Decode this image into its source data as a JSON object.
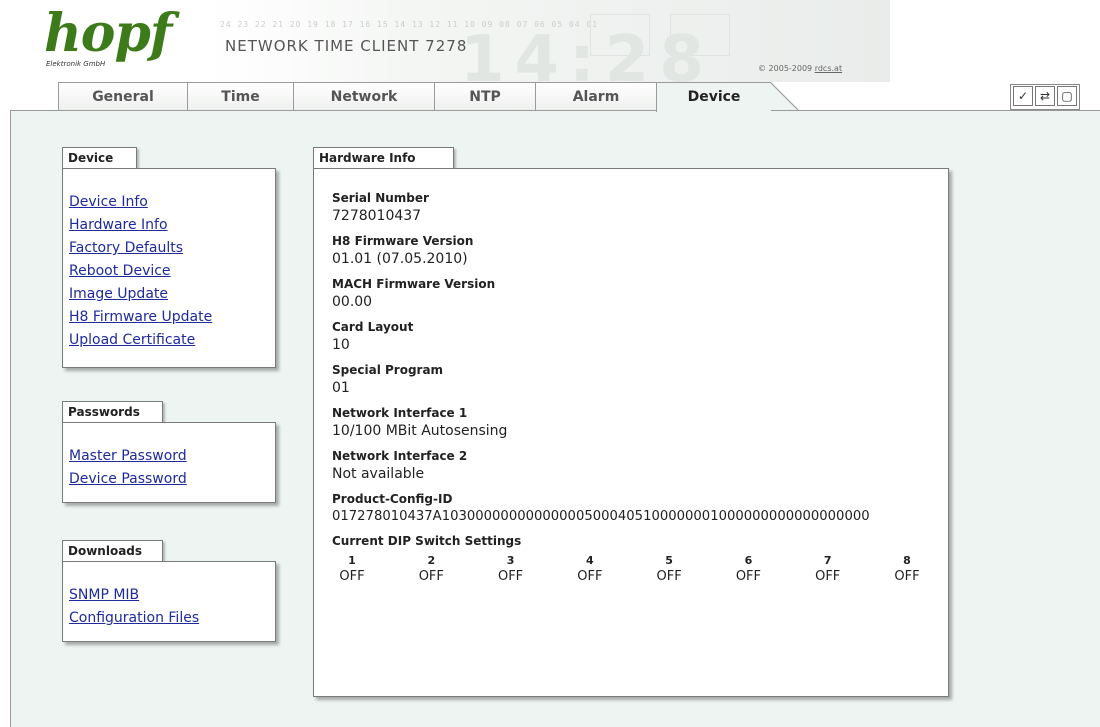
{
  "header": {
    "logo_text": "hopf",
    "logo_sub": "Elektronik GmbH",
    "title": "NETWORK TIME CLIENT 7278",
    "banner_ticks": "24 23 22 21 20 19 18 17 16 15 14 13 12 11 10 09 08 07 06 05 04 01",
    "banner_clock": "14:28",
    "copyright_text": "© 2005-2009",
    "copyright_link": "rdcs.at"
  },
  "tabs": [
    {
      "label": "General"
    },
    {
      "label": "Time"
    },
    {
      "label": "Network"
    },
    {
      "label": "NTP"
    },
    {
      "label": "Alarm"
    },
    {
      "label": "Device",
      "active": true
    }
  ],
  "toolbar_icons": [
    "check-icon",
    "refresh-icon",
    "page-icon"
  ],
  "sidebar": {
    "device": {
      "title": "Device",
      "links": [
        "Device Info",
        "Hardware Info",
        "Factory Defaults",
        "Reboot Device",
        "Image Update",
        "H8 Firmware Update",
        "Upload Certificate"
      ]
    },
    "passwords": {
      "title": "Passwords",
      "links": [
        "Master Password",
        "Device Password"
      ]
    },
    "downloads": {
      "title": "Downloads",
      "links": [
        "SNMP MIB",
        "Configuration Files"
      ]
    }
  },
  "hardware_info": {
    "title": "Hardware Info",
    "fields": [
      {
        "label": "Serial Number",
        "value": "7278010437"
      },
      {
        "label": "H8 Firmware Version",
        "value": "01.01 (07.05.2010)"
      },
      {
        "label": "MACH Firmware Version",
        "value": "00.00"
      },
      {
        "label": "Card Layout",
        "value": "10"
      },
      {
        "label": "Special Program",
        "value": "01"
      },
      {
        "label": "Network Interface 1",
        "value": "10/100 MBit Autosensing"
      },
      {
        "label": "Network Interface 2",
        "value": "Not available"
      },
      {
        "label": "Product-Config-ID",
        "value": "017278010437A103000000000000005000405100000001000000000000000000"
      }
    ],
    "dip_title": "Current DIP Switch Settings",
    "dip_numbers": [
      "1",
      "2",
      "3",
      "4",
      "5",
      "6",
      "7",
      "8"
    ],
    "dip_values": [
      "OFF",
      "OFF",
      "OFF",
      "OFF",
      "OFF",
      "OFF",
      "OFF",
      "OFF"
    ]
  },
  "colors": {
    "logo_green": "#3d7a19",
    "link_blue": "#1f2a9c",
    "content_bg": "#edf4f1"
  }
}
